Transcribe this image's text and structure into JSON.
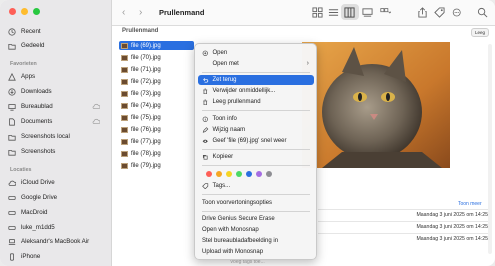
{
  "window": {
    "title": "Prullenmand"
  },
  "colors": {
    "accent": "#2a6fe0",
    "close": "#fe5f57",
    "minimize": "#febc2e",
    "zoom": "#28c840"
  },
  "sidebar": {
    "top_items": [
      {
        "label": "Recent",
        "icon": "clock-icon"
      },
      {
        "label": "Gedeeld",
        "icon": "shared-folder-icon"
      }
    ],
    "favorites_header": "Favorieten",
    "favorites": [
      {
        "label": "Apps",
        "icon": "apps-icon"
      },
      {
        "label": "Downloads",
        "icon": "download-icon"
      },
      {
        "label": "Bureaublad",
        "icon": "desktop-icon"
      },
      {
        "label": "Documents",
        "icon": "document-icon"
      },
      {
        "label": "Screenshots local",
        "icon": "folder-icon"
      },
      {
        "label": "Screenshots",
        "icon": "folder-icon"
      }
    ],
    "locations_header": "Locaties",
    "locations": [
      {
        "label": "iCloud Drive",
        "icon": "cloud-icon"
      },
      {
        "label": "Google Drive",
        "icon": "drive-icon"
      },
      {
        "label": "MacDroid",
        "icon": "drive-icon"
      },
      {
        "label": "luke_m1dd5",
        "icon": "drive-icon"
      },
      {
        "label": "Aleksandr's MacBook Air",
        "icon": "laptop-icon"
      },
      {
        "label": "iPhone",
        "icon": "phone-icon"
      }
    ]
  },
  "content": {
    "path": "Prullenmand",
    "empty_button": "Leeg",
    "files": [
      "file (69).jpg",
      "file (70).jpg",
      "file (71).jpg",
      "file (72).jpg",
      "file (73).jpg",
      "file (74).jpg",
      "file (75).jpg",
      "file (76).jpg",
      "file (77).jpg",
      "file (78).jpg",
      "file (79).jpg"
    ],
    "selected_index": 0,
    "show_more": "Toon meer",
    "dates": [
      "Maandag 3 juni 2025 om 14:25",
      "Maandag 3 juni 2025 om 14:25",
      "Maandag 3 juni 2025 om 14:25"
    ],
    "bottom_hint": "Voeg tags toe..."
  },
  "menu": {
    "items": [
      {
        "label": "Open",
        "icon": "open-icon"
      },
      {
        "label": "Open met",
        "icon": "",
        "submenu": true
      },
      {
        "label": "Zet terug",
        "icon": "undo-icon",
        "highlighted": true
      },
      {
        "label": "Verwijder onmiddellijk...",
        "icon": "trash-icon"
      },
      {
        "label": "Leeg prullenmand",
        "icon": "trash-icon"
      },
      {
        "label": "Toon info",
        "icon": "info-icon"
      },
      {
        "label": "Wijzig naam",
        "icon": "pencil-icon"
      },
      {
        "label": "Geef 'file (69).jpg' snel weer",
        "icon": "eye-icon"
      },
      {
        "label": "Kopieer",
        "icon": "copy-icon"
      },
      {
        "label": "Tags...",
        "icon": "tag-icon"
      },
      {
        "label": "Toon voorvertoningsopties",
        "icon": ""
      },
      {
        "label": "Drive Genius Secure Erase",
        "icon": ""
      },
      {
        "label": "Open with Monosnap",
        "icon": ""
      },
      {
        "label": "Stel bureaubladafbeelding in",
        "icon": ""
      },
      {
        "label": "Upload with Monosnap",
        "icon": ""
      }
    ],
    "tag_colors": [
      "#fe5f57",
      "#f5a623",
      "#f5d423",
      "#4cd964",
      "#2a6fe0",
      "#a56de2",
      "#8e8e93"
    ]
  }
}
